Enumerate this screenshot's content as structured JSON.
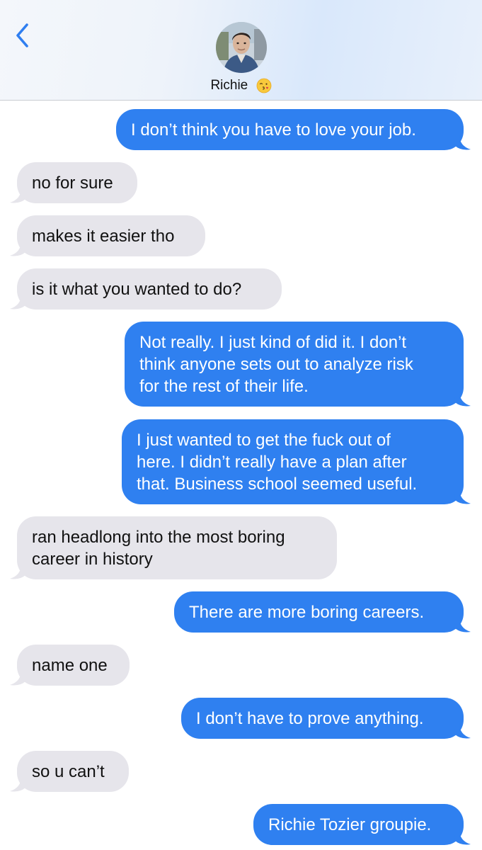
{
  "header": {
    "contact_name": "Richie",
    "back_icon": "chevron-left-icon",
    "avatar_icon": "contact-avatar",
    "emoji_icon": "kissing-face-emoji",
    "accent_color": "#2f80f0"
  },
  "messages": [
    {
      "direction": "out",
      "lines": [
        "I don’t think you have to love your job."
      ]
    },
    {
      "direction": "in",
      "lines": [
        "no for sure"
      ]
    },
    {
      "direction": "in",
      "lines": [
        "makes it easier tho"
      ]
    },
    {
      "direction": "in",
      "lines": [
        "is it what you wanted to do?"
      ]
    },
    {
      "direction": "out",
      "lines": [
        "Not really. I just kind of did it. I don’t",
        "think anyone sets out to analyze risk",
        "for the rest of their life."
      ]
    },
    {
      "direction": "out",
      "lines": [
        "I just wanted to get the fuck out of",
        "here. I didn’t really have a plan after",
        "that. Business school seemed useful."
      ]
    },
    {
      "direction": "in",
      "lines": [
        "ran headlong into the most boring",
        "career in history"
      ]
    },
    {
      "direction": "out",
      "lines": [
        "There are more boring careers."
      ]
    },
    {
      "direction": "in",
      "lines": [
        "name one"
      ]
    },
    {
      "direction": "out",
      "lines": [
        "I don’t have to prove anything."
      ]
    },
    {
      "direction": "in",
      "lines": [
        "so u can’t"
      ]
    },
    {
      "direction": "out",
      "lines": [
        "Richie Tozier groupie."
      ]
    }
  ]
}
